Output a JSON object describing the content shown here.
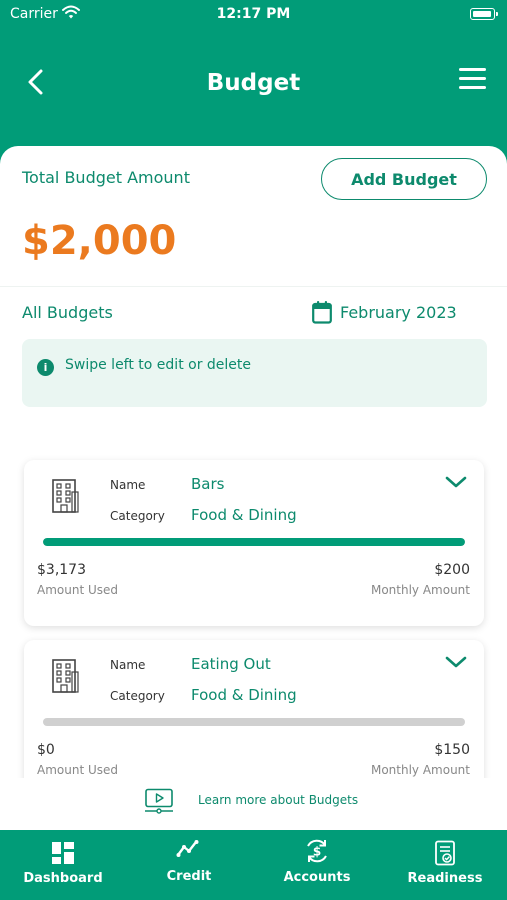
{
  "status_bar": {
    "carrier": "Carrier",
    "time": "12:17 PM"
  },
  "header": {
    "title": "Budget"
  },
  "summary": {
    "total_label": "Total Budget Amount",
    "add_button": "Add Budget",
    "total_amount": "$2,000"
  },
  "filter": {
    "all_budgets": "All Budgets",
    "date": "February 2023"
  },
  "info": {
    "text": "Swipe left to edit or delete"
  },
  "budgets": [
    {
      "name_label": "Name",
      "name": "Bars",
      "category_label": "Category",
      "category": "Food & Dining",
      "progress": 1.0,
      "amount_used": "$3,173",
      "amount_used_label": "Amount Used",
      "monthly_amount": "$200",
      "monthly_amount_label": "Monthly Amount"
    },
    {
      "name_label": "Name",
      "name": "Eating Out",
      "category_label": "Category",
      "category": "Food & Dining",
      "progress": 0.0,
      "amount_used": "$0",
      "amount_used_label": "Amount Used",
      "monthly_amount": "$150",
      "monthly_amount_label": "Monthly Amount"
    }
  ],
  "learn_more": "Learn more about Budgets",
  "tabbar": [
    {
      "label": "Dashboard",
      "icon": "dashboard-icon"
    },
    {
      "label": "Credit",
      "icon": "trend-line-icon"
    },
    {
      "label": "Accounts",
      "icon": "dollar-exchange-icon"
    },
    {
      "label": "Readiness",
      "icon": "checklist-icon"
    }
  ],
  "colors": {
    "brand": "#019c78",
    "text_green": "#0d8a6d",
    "amount_orange": "#eb7a1f"
  }
}
